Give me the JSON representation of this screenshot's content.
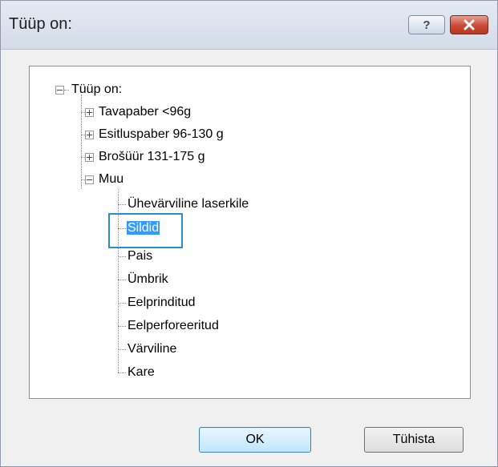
{
  "window": {
    "title": "Tüüp on:",
    "help_symbol": "?",
    "close_symbol": "✕"
  },
  "tree": {
    "root": "Tüüp on:",
    "groups": [
      {
        "label": "Tavapaber <96g",
        "expanded": false
      },
      {
        "label": "Esitluspaber 96-130 g",
        "expanded": false
      },
      {
        "label": "Brošüür 131-175 g",
        "expanded": false
      },
      {
        "label": "Muu",
        "expanded": true
      }
    ],
    "muu_items": [
      "Ühevärviline laserkile",
      "Sildid",
      "Pais",
      "Ümbrik",
      "Eelprinditud",
      "Eelperforeeritud",
      "Värviline",
      "Kare"
    ],
    "selected_item": "Sildid"
  },
  "buttons": {
    "ok": "OK",
    "cancel": "Tühista"
  },
  "colors": {
    "selection": "#3399ff",
    "highlight_border": "#2a8fd0",
    "close_button": "#c94a36"
  }
}
